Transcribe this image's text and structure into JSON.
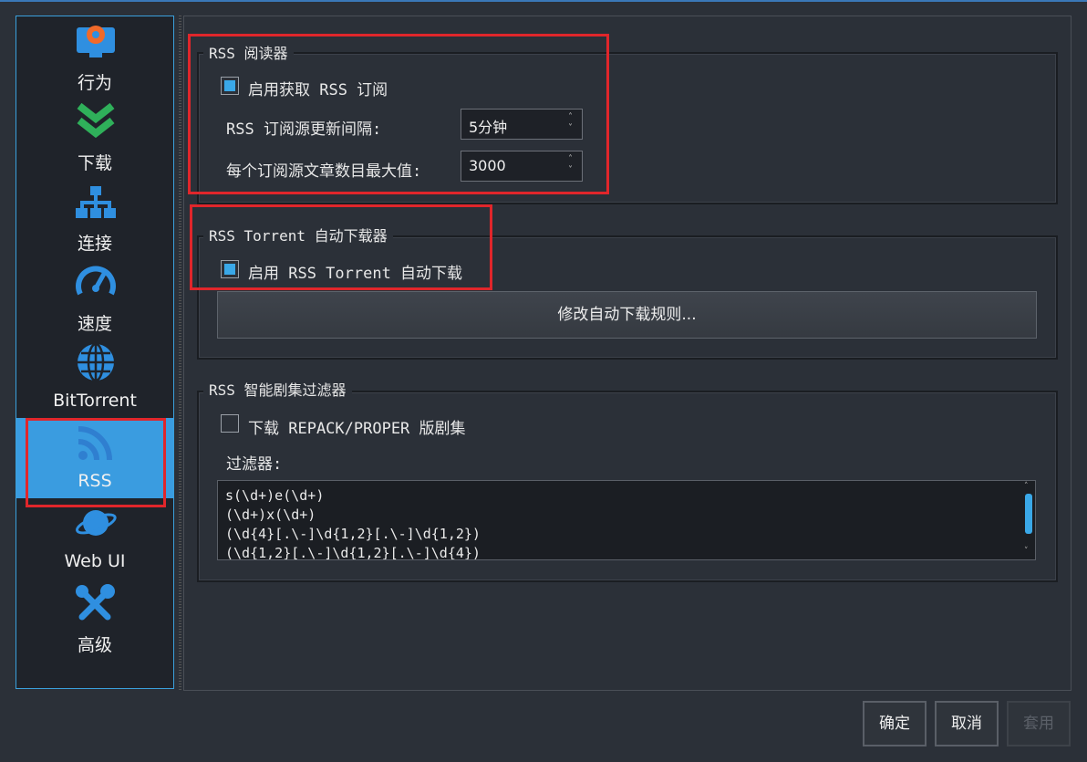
{
  "sidebar": {
    "items": [
      {
        "label": "行为",
        "icon": "monitor-gear-icon"
      },
      {
        "label": "下载",
        "icon": "double-chevron-down-icon"
      },
      {
        "label": "连接",
        "icon": "network-icon"
      },
      {
        "label": "速度",
        "icon": "speedometer-icon"
      },
      {
        "label": "BitTorrent",
        "icon": "globe-icon"
      },
      {
        "label": "RSS",
        "icon": "rss-icon",
        "active": true
      },
      {
        "label": "Web UI",
        "icon": "planet-icon"
      },
      {
        "label": "高级",
        "icon": "tools-icon"
      }
    ]
  },
  "rss_reader": {
    "title": "RSS 阅读器",
    "enable_label": "启用获取 RSS 订阅",
    "enable_checked": true,
    "interval_label": "RSS 订阅源更新间隔:",
    "interval_value": "5分钟",
    "max_articles_label": "每个订阅源文章数目最大值:",
    "max_articles_value": "3000"
  },
  "auto_downloader": {
    "title": "RSS Torrent 自动下载器",
    "enable_label": "启用 RSS Torrent 自动下载",
    "enable_checked": true,
    "edit_rules_button": "修改自动下载规则..."
  },
  "smart_filter": {
    "title": "RSS 智能剧集过滤器",
    "repack_label": "下载 REPACK/PROPER 版剧集",
    "repack_checked": false,
    "filters_label": "过滤器:",
    "filters": [
      "s(\\d+)e(\\d+)",
      "(\\d+)x(\\d+)",
      "(\\d{4}[.\\-]\\d{1,2}[.\\-]\\d{1,2})",
      "(\\d{1,2}[.\\-]\\d{1,2}[.\\-]\\d{4})"
    ]
  },
  "footer": {
    "ok": "确定",
    "cancel": "取消",
    "apply": "套用"
  },
  "colors": {
    "accent": "#3a9ce0",
    "highlight": "#e0262b",
    "background": "#2b3038"
  }
}
